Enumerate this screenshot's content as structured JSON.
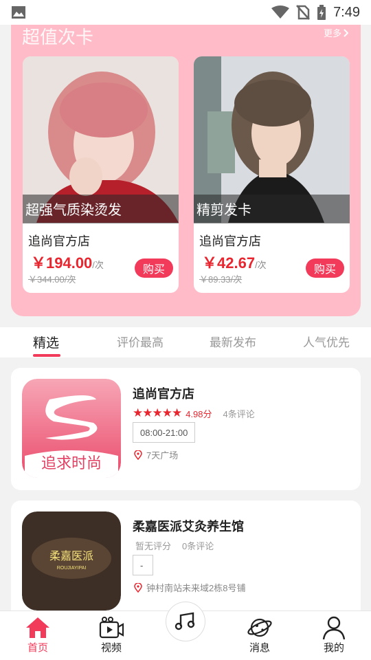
{
  "status_bar": {
    "time": "7:49"
  },
  "promo": {
    "title": "超值次卡",
    "more_label": "更多",
    "cards": [
      {
        "caption": "超强气质染烫发",
        "store": "追尚官方店",
        "price": "￥194.00",
        "unit": "/次",
        "original": "￥344.00/次",
        "buy_label": "购买"
      },
      {
        "caption": "精剪发卡",
        "store": "追尚官方店",
        "price": "￥42.67",
        "unit": "/次",
        "original": "￥89.33/次",
        "buy_label": "购买"
      }
    ]
  },
  "tabs": [
    {
      "label": "精选",
      "active": true
    },
    {
      "label": "评价最高",
      "active": false
    },
    {
      "label": "最新发布",
      "active": false
    },
    {
      "label": "人气优先",
      "active": false
    }
  ],
  "shops": [
    {
      "name": "追尚官方店",
      "stars": 4.5,
      "score": "4.98分",
      "reviews": "4条评论",
      "hours": "08:00-21:00",
      "address": "7天广场",
      "logo_text": "追求时尚"
    },
    {
      "name": "柔嘉医派艾灸养生馆",
      "score_text": "暂无评分",
      "reviews": "0条评论",
      "hours": "-",
      "address": "钟村南站未来域2栋8号铺",
      "logo_text": "柔嘉医派",
      "logo_subtext": "ROUJIAYIPAI"
    }
  ],
  "nav": {
    "items": [
      {
        "label": "首页",
        "icon": "home-icon",
        "active": true
      },
      {
        "label": "视频",
        "icon": "video-icon",
        "active": false
      },
      {
        "label": "",
        "icon": "music-icon",
        "active": false
      },
      {
        "label": "消息",
        "icon": "planet-icon",
        "active": false
      },
      {
        "label": "我的",
        "icon": "user-icon",
        "active": false
      }
    ]
  },
  "colors": {
    "accent": "#f23a5a",
    "price_red": "#e8262f",
    "promo_bg": "#ffbcc8"
  }
}
